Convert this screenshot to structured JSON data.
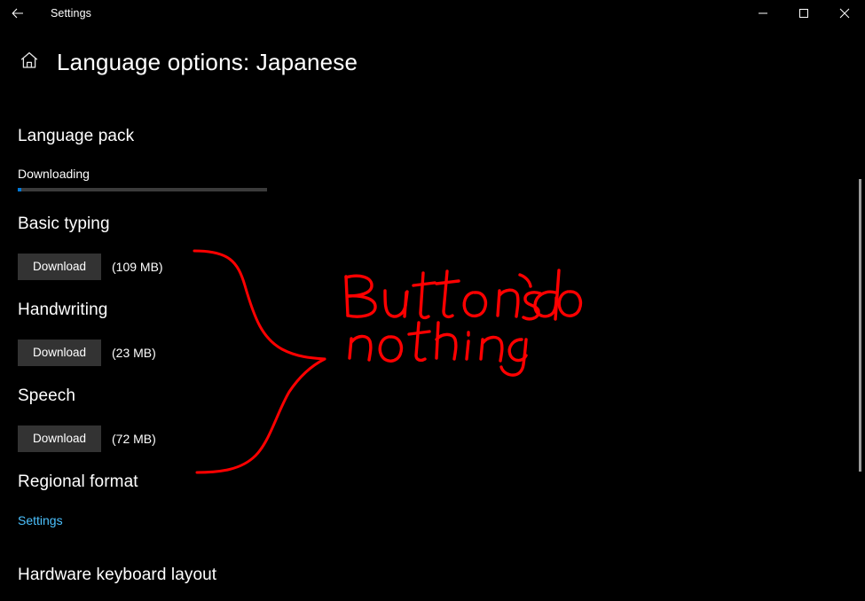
{
  "window": {
    "app_title": "Settings",
    "back_icon": "back-arrow-icon",
    "minimize_label": "—",
    "maximize_label": "☐",
    "close_label": "✕"
  },
  "header": {
    "home_icon": "home-icon",
    "page_title": "Language options: Japanese"
  },
  "sections": {
    "language_pack": {
      "heading": "Language pack",
      "status": "Downloading",
      "progress_percent": 1.5,
      "progress_color": "#0078d7",
      "track_color": "#3b3b3b"
    },
    "basic_typing": {
      "heading": "Basic typing",
      "button_label": "Download",
      "size_label": "(109 MB)"
    },
    "handwriting": {
      "heading": "Handwriting",
      "button_label": "Download",
      "size_label": "(23 MB)"
    },
    "speech": {
      "heading": "Speech",
      "button_label": "Download",
      "size_label": "(72 MB)"
    },
    "regional_format": {
      "heading": "Regional format",
      "link_label": "Settings",
      "link_color": "#4cc2ff"
    },
    "hardware_keyboard_layout": {
      "heading": "Hardware keyboard layout"
    }
  },
  "annotation": {
    "ink_color": "#ff0000",
    "line_1": "Buttons do",
    "line_2": "nothing",
    "full_text": "Buttons do nothing",
    "shape": "curly-brace pointing right at the three Download buttons"
  },
  "scrollbar": {
    "name": "vertical-scrollbar",
    "thumb_color": "#9a9a9a"
  }
}
